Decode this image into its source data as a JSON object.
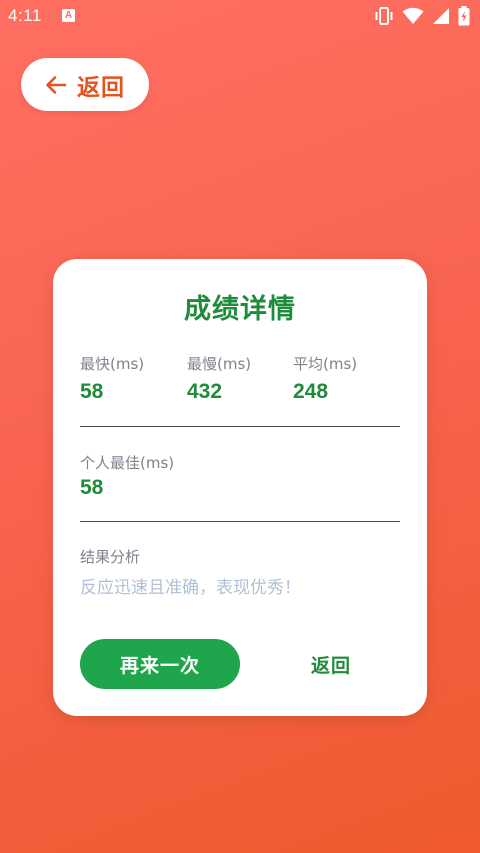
{
  "status_bar": {
    "time": "4:11",
    "notification_icon": "accessibility-a-icon",
    "icons": [
      "vibrate-icon",
      "wifi-icon",
      "signal-icon",
      "battery-charging-icon"
    ]
  },
  "header": {
    "back_label": "返回",
    "back_icon": "arrow-left-icon"
  },
  "card": {
    "title": "成绩详情",
    "stats": [
      {
        "label": "最快(ms)",
        "value": "58"
      },
      {
        "label": "最慢(ms)",
        "value": "432"
      },
      {
        "label": "平均(ms)",
        "value": "248"
      }
    ],
    "best": {
      "label": "个人最佳(ms)",
      "value": "58"
    },
    "analysis": {
      "label": "结果分析",
      "text": "反应迅速且准确，表现优秀！"
    },
    "actions": {
      "retry_label": "再来一次",
      "return_label": "返回"
    }
  },
  "colors": {
    "background_start": "#FF6F61",
    "background_end": "#EE5A2D",
    "accent_green": "#1E8C3A",
    "button_green": "#1FA64C",
    "back_orange": "#E4541F"
  }
}
